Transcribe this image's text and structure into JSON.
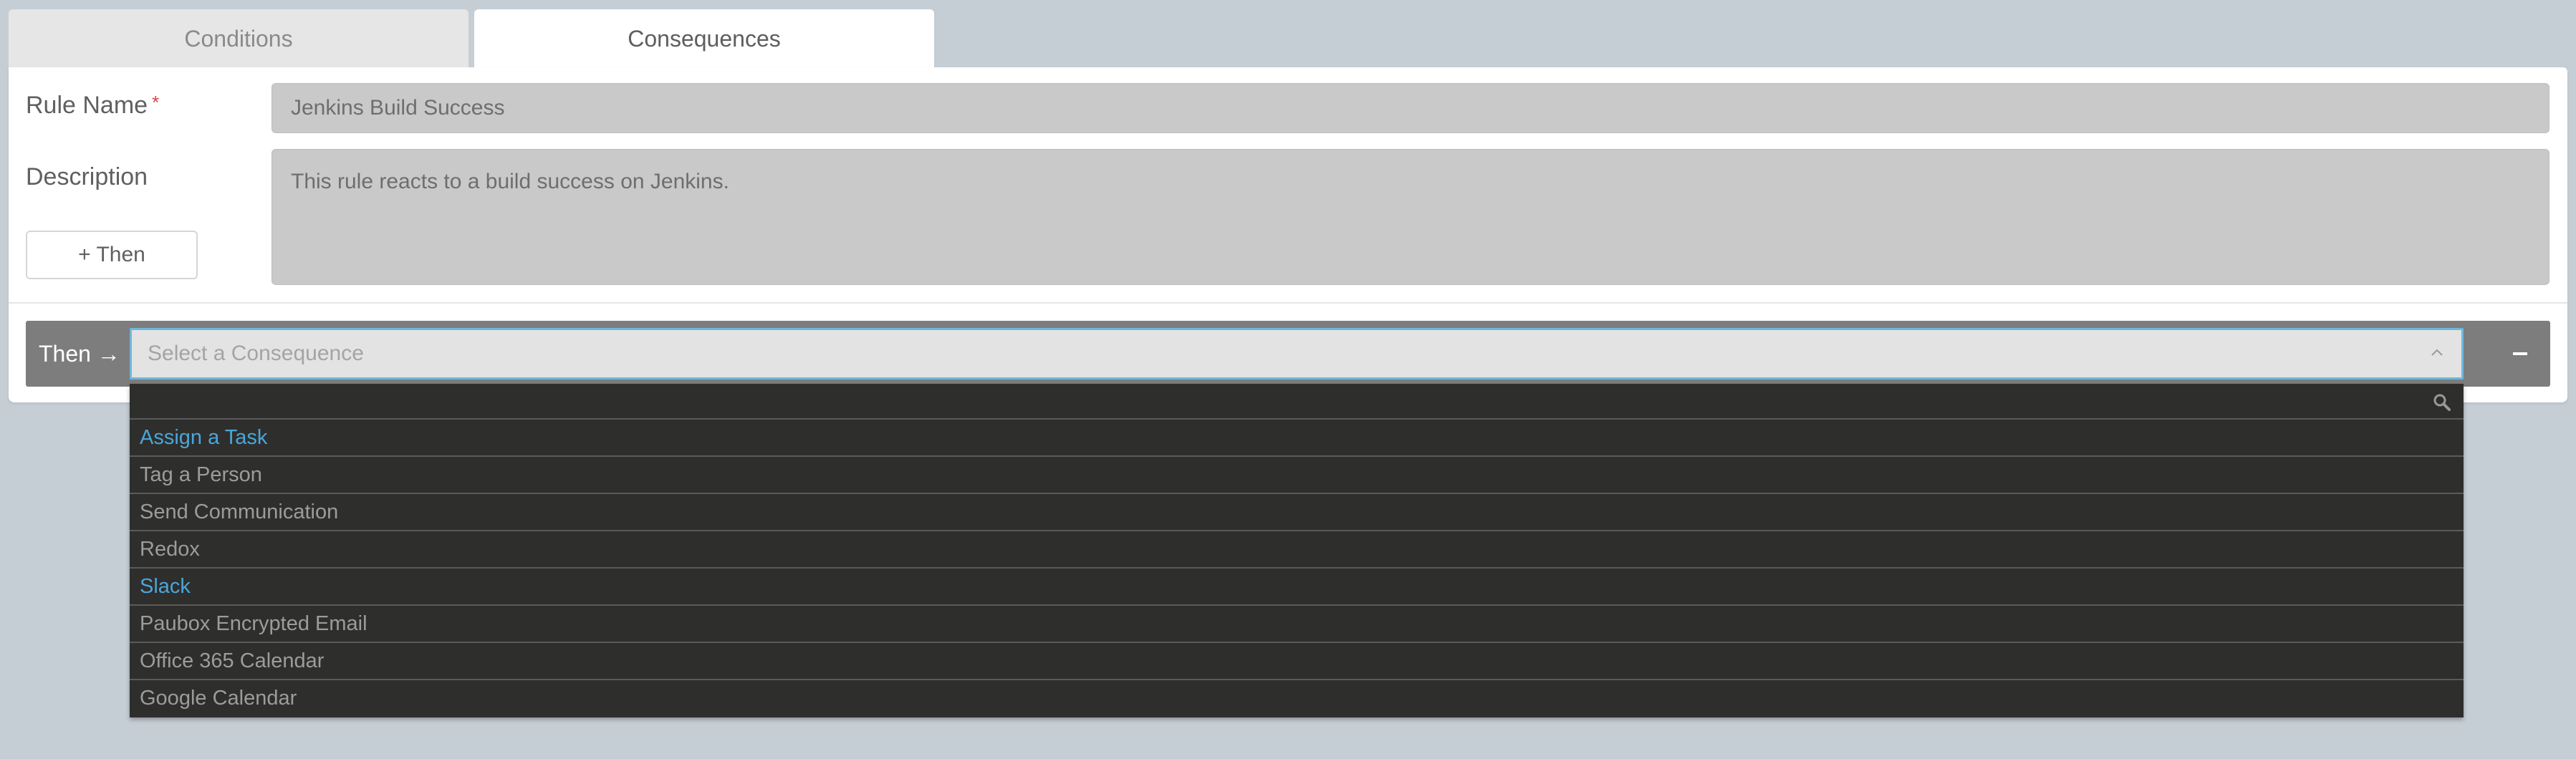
{
  "tabs": {
    "conditions": "Conditions",
    "consequences": "Consequences"
  },
  "form": {
    "rule_name_label": "Rule Name",
    "required_mark": "*",
    "rule_name_value": "Jenkins Build Success",
    "description_label": "Description",
    "description_value": "This rule reacts to a build success on Jenkins.",
    "add_then_label": "+ Then"
  },
  "consequence": {
    "then_label": "Then →",
    "select_placeholder": "Select a Consequence",
    "search_value": "",
    "options": [
      {
        "label": "Assign a Task",
        "highlight": true
      },
      {
        "label": "Tag a Person",
        "highlight": false
      },
      {
        "label": "Send Communication",
        "highlight": false
      },
      {
        "label": "Redox",
        "highlight": false
      },
      {
        "label": "Slack",
        "highlight": true
      },
      {
        "label": "Paubox Encrypted Email",
        "highlight": false
      },
      {
        "label": "Office 365 Calendar",
        "highlight": false
      },
      {
        "label": "Google Calendar",
        "highlight": false
      }
    ]
  },
  "colors": {
    "background": "#c6ced5",
    "accent": "#4aa6da",
    "then_bar": "#7d7d7d",
    "dropdown_bg": "#2e2e2c",
    "select_focus_border": "#6fb7dd"
  },
  "icons": {
    "select_chevron": "chevron-up-icon",
    "remove": "minus-icon",
    "search": "search-icon"
  }
}
